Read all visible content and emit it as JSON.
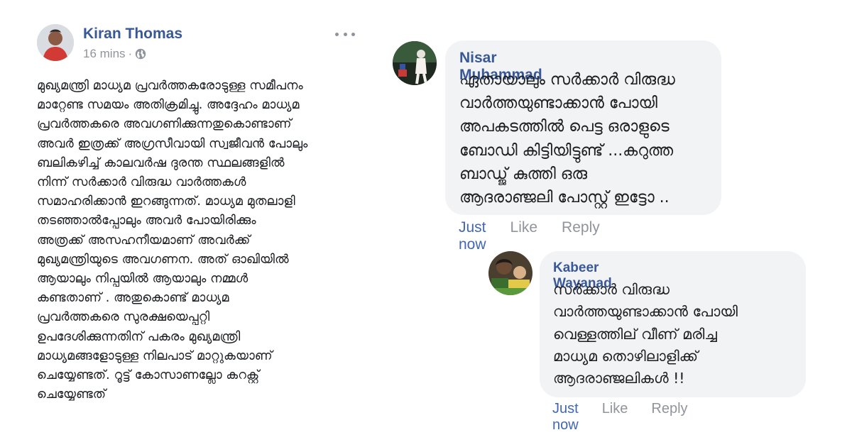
{
  "post": {
    "author": "Kiran Thomas",
    "time": "16 mins",
    "separator": "·",
    "privacy_icon": "globe-icon",
    "more_icon": "more-options-icon",
    "body": "മുഖ്യമന്ത്രി മാധ്യമ പ്രവർത്തകരോടുള്ള സമീപനം\nമാറ്റേണ്ട സമയം അതിക്രമിച്ചു. അദ്ദേഹം മാധ്യമ\nപ്രവർത്തകരെ അവഗണിക്കുന്നതുകൊണ്ടാണ്\nഅവർ ഇത്രക്ക് അഗ്രസീവായി സ്വജീവൻ പോലും\nബലികഴിച്ച് കാലവർഷ ദുരന്ത സ്ഥലങ്ങളിൽ\nനിന്ന് സർക്കാർ വിരുദ്ധ വാർത്തകൾ\nസമാഹരിക്കാൻ ഇറങ്ങുന്നത്. മാധ്യമ മുതലാളി\nതടഞ്ഞാൽപ്പോലും അവർ പോയിരിക്കും\nഅത്രക്ക് അസഹനീയമാണ് അവർക്ക്\nമുഖ്യമന്ത്രിയുടെ അവഗണന. അത് ഓഖിയിൽ\nആയാലും നിപ്പയിൽ ആയാലും നമ്മൾ\nകണ്ടതാണ് . അതുകൊണ്ട് മാധ്യമ\nപ്രവർത്തകരെ സുരക്ഷയെപ്പറ്റി\nഉപദേശിക്കുന്നതിന് പകരം മുഖ്യമന്ത്രി\nമാധ്യമങ്ങളോടുള്ള നിലപാട് മാറ്റുകയാണ്\nചെയ്യേണ്ടത്. റൂട്ട് കോസാണല്ലോ കറക്റ്റ്\nചെയ്യേണ്ടത്"
  },
  "comments": [
    {
      "author": "Nisar Muhammad",
      "text": "ഏതായാലും സർക്കാർ വിരുദ്ധ\nവാർത്തയുണ്ടാക്കാൻ  പോയി\nഅപകടത്തിൽ പെട്ട ഒരാളുടെ\nബോഡി കിട്ടിയിട്ടുണ്ട് ...കറുത്ത\nബാഡ്ജ്  കുത്തി ഒരു\nആദരാഞ്ജലി  പോസ്റ്റ് ഇട്ടോ ..",
      "time": "Just now",
      "like": "Like",
      "reply": "Reply"
    },
    {
      "author": "Kabeer Wayanad",
      "text": "സർക്കാർ വിരുദ്ധ\nവാർത്തയുണ്ടാക്കാൻ പോയി\nവെള്ളത്തില് വീണ് മരിച്ച\nമാധ്യമ തൊഴിലാളിക്ക്\nആദരാഞ്ജലികൾ !!",
      "time": "Just now",
      "like": "Like",
      "reply": "Reply"
    }
  ],
  "colors": {
    "author_link": "#385898",
    "meta_gray": "#90949c",
    "bubble_bg": "#f2f3f5",
    "timestamp_blue": "#4267b2"
  }
}
